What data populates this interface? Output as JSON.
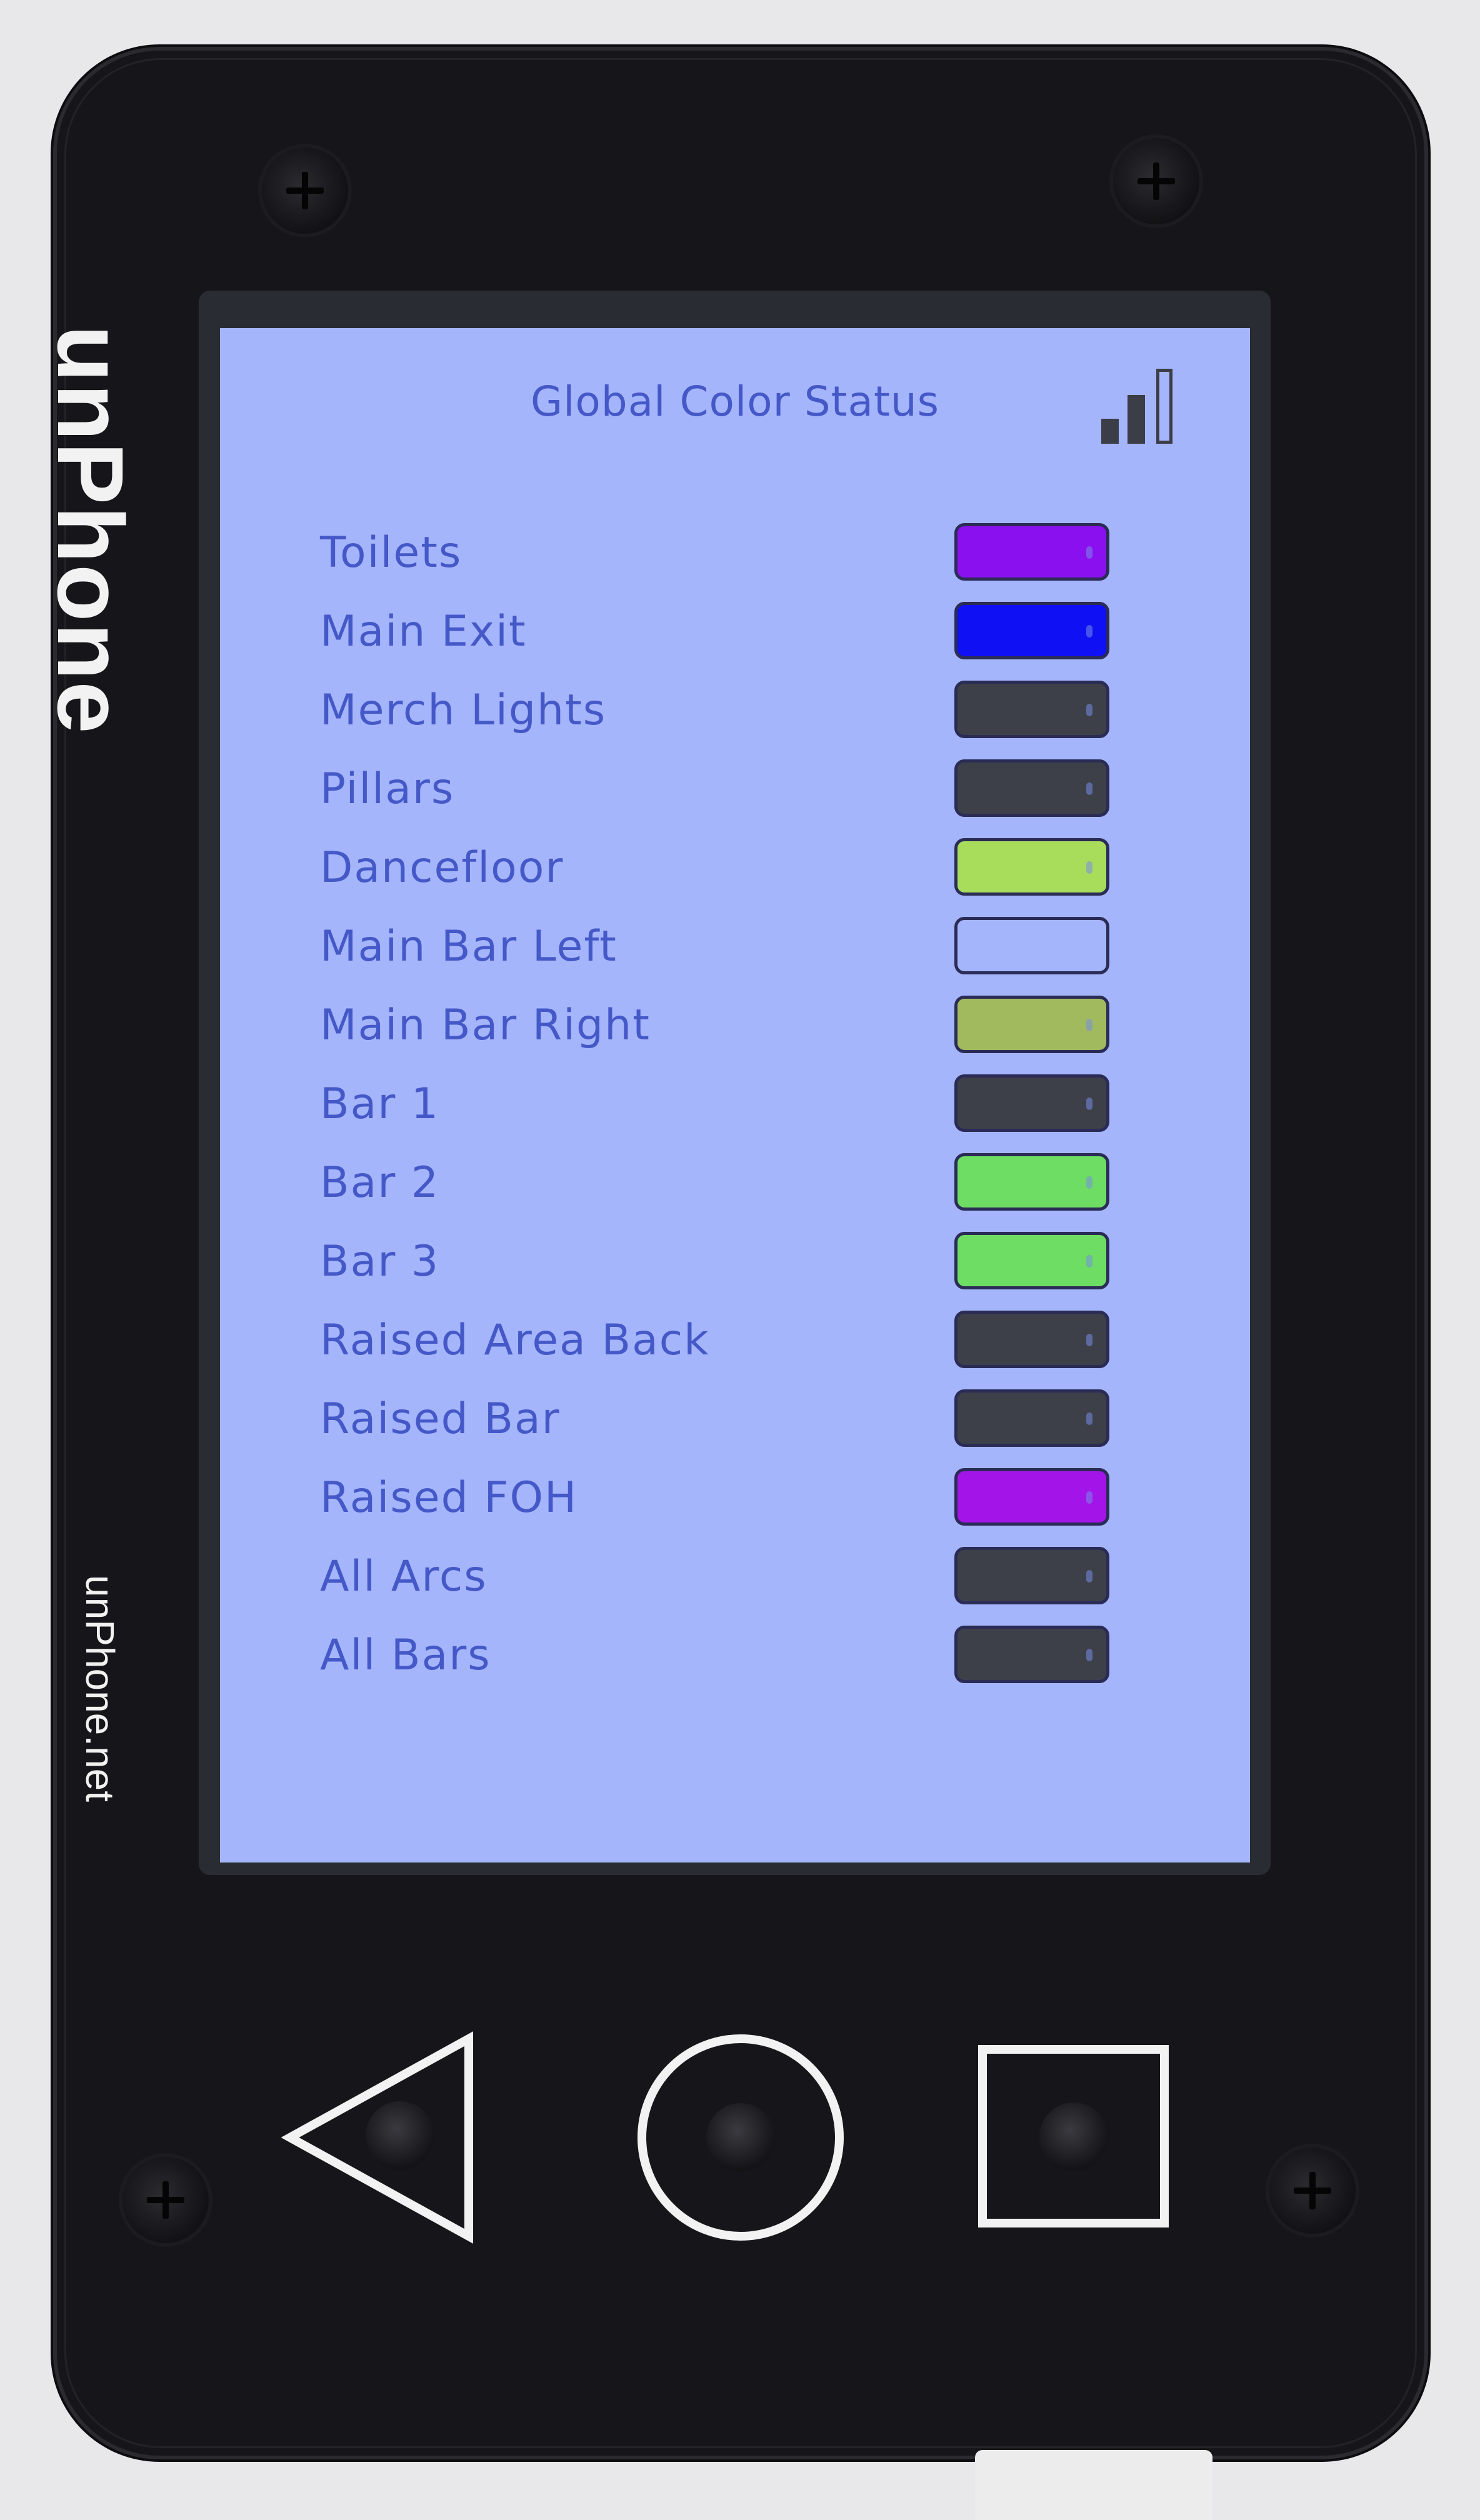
{
  "device": {
    "brand": "unPhone",
    "url": "unPhone.net"
  },
  "screen": {
    "title": "Global Color Status",
    "status_icon": "signal-strength-icon",
    "items": [
      {
        "label": "Toilets",
        "color": "#8a10ef"
      },
      {
        "label": "Main Exit",
        "color": "#1010f5"
      },
      {
        "label": "Merch Lights",
        "color": "#3d4049"
      },
      {
        "label": "Pillars",
        "color": "#3d4049"
      },
      {
        "label": "Dancefloor",
        "color": "#a8dd5c"
      },
      {
        "label": "Main Bar Left",
        "color": "#a5b5fb"
      },
      {
        "label": "Main Bar Right",
        "color": "#a2ba5e"
      },
      {
        "label": "Bar 1",
        "color": "#3d4049"
      },
      {
        "label": "Bar 2",
        "color": "#6ddd63"
      },
      {
        "label": "Bar 3",
        "color": "#6ddd63"
      },
      {
        "label": "Raised Area Back",
        "color": "#3d4049"
      },
      {
        "label": "Raised Bar",
        "color": "#3d4049"
      },
      {
        "label": "Raised FOH",
        "color": "#a314e8"
      },
      {
        "label": "All Arcs",
        "color": "#3d4049"
      },
      {
        "label": "All Bars",
        "color": "#3d4049"
      }
    ]
  },
  "nav": {
    "back_icon": "triangle-back-icon",
    "home_icon": "circle-home-icon",
    "recent_icon": "square-recent-icon"
  }
}
